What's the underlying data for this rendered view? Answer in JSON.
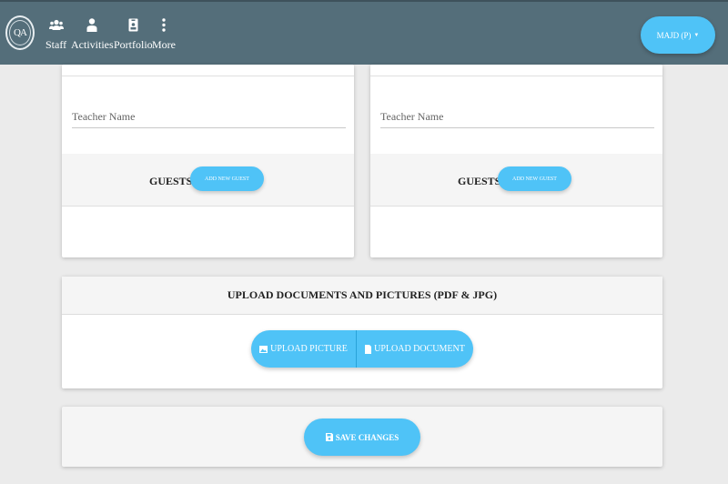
{
  "nav": {
    "logo_text": "QA",
    "items": [
      {
        "label": "Staff",
        "icon": "users-icon"
      },
      {
        "label": "Activities",
        "icon": "person-icon"
      },
      {
        "label": "Portfolio",
        "icon": "badge-icon"
      },
      {
        "label": "More",
        "icon": "more-vertical-icon"
      }
    ],
    "user_label": "MAJD (P)",
    "user_caret": "▼"
  },
  "cards": [
    {
      "teacher_placeholder": "Teacher Name",
      "guests_label": "GUESTS",
      "add_guest_label": "ADD NEW GUEST"
    },
    {
      "teacher_placeholder": "Teacher Name",
      "guests_label": "GUESTS",
      "add_guest_label": "ADD NEW GUEST"
    }
  ],
  "upload": {
    "title": "UPLOAD DOCUMENTS AND PICTURES (PDF & JPG)",
    "picture_label": "UPLOAD PICTURE",
    "document_label": "UPLOAD DOCUMENT"
  },
  "save": {
    "label": "SAVE CHANGES"
  },
  "colors": {
    "topbar": "#546e7a",
    "accent": "#4fc3f7",
    "page_bg": "#ebebeb"
  }
}
